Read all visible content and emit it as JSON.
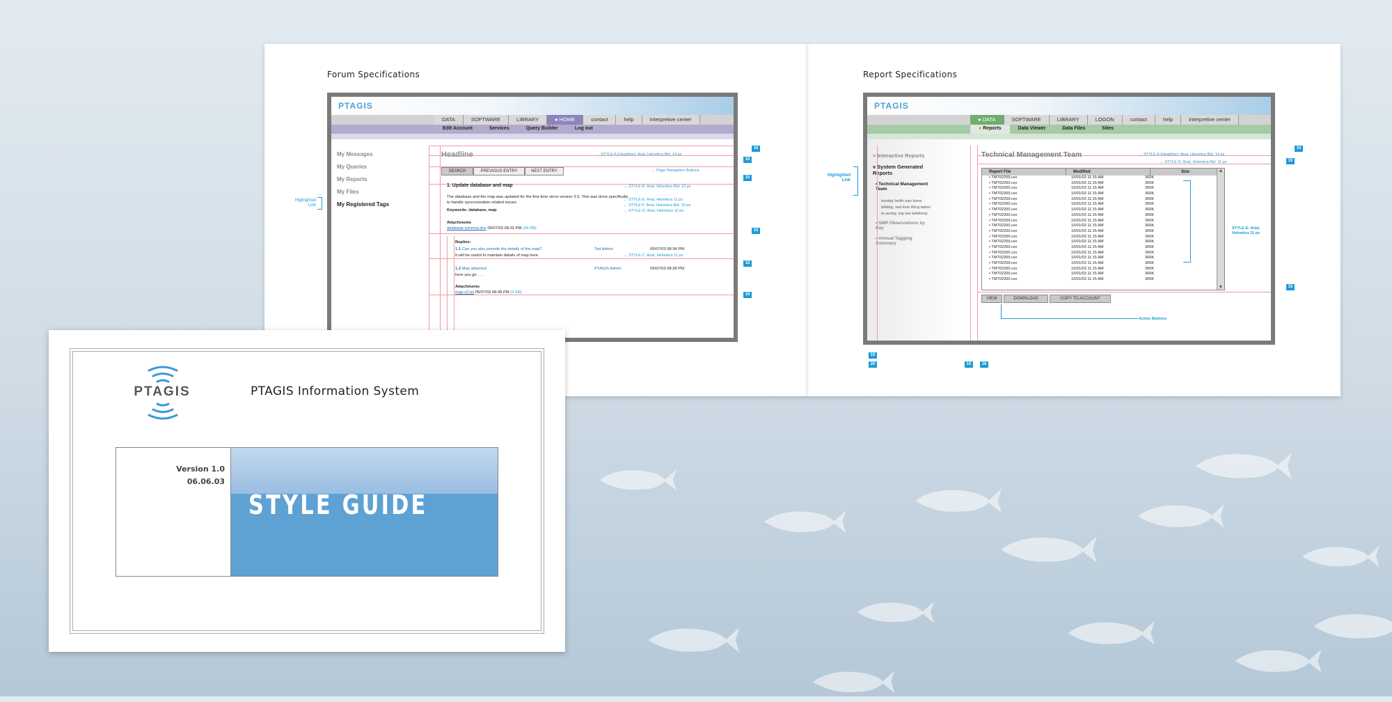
{
  "forum": {
    "title": "Forum Specifications",
    "logo": "PTAGIS",
    "nav": [
      "DATA",
      "SOFTWARE",
      "LIBRARY",
      "HOME",
      "contact",
      "help",
      "interpretive center"
    ],
    "subnav": [
      "Edit Account",
      "Services",
      "Query Builder",
      "Log out"
    ],
    "sidebar": [
      "My Messages",
      "My Queries",
      "My Reports",
      "My Files",
      "My Registered Tags"
    ],
    "highlighted_note": "Highlighted Link",
    "headline": "Headline",
    "buttons": {
      "search": "SEARCH",
      "previous": "PREVIOUS ENTRY",
      "next": "NEXT ENTRY"
    },
    "post_title": "1. Update database and map",
    "post_body_1": "The database and the map was updated for the first time since version 3.5. This was done specifically",
    "post_body_2": "to handle syncronization related issues.",
    "keywords": "Keywords: database, map",
    "attachments_label": "Attachments",
    "attachment1_name": "database schema.doc",
    "attachment1_date": "05/07/03  08:32 PM",
    "attachment1_size": "(35 KB)",
    "replies_label": "Replies:",
    "reply1_num": "1.1",
    "reply1_title": "Can you also provide the details of the map?",
    "reply1_author": "Ted Admin",
    "reply1_date": "05/07/03  08:34 PM",
    "reply1_body": "It will be useful to maintain details of map here.",
    "reply2_num": "1.2",
    "reply2_title": "Map attached",
    "reply2_author": "PTAGIS Admin",
    "reply2_date": "05/07/03  08:38 PM",
    "reply2_body": "here you go . . .",
    "attachment2_name": "map-v2.txt",
    "attachment2_date": "05/07/03  08:38 PM",
    "attachment2_size": "(3 KB)",
    "notes": {
      "a": "STYLE A (Headline): Arial, Helvetica Bld.  14 px",
      "page_nav": "Page Navigation Buttons",
      "b": "STYLE B: Arial, Helvetica Bld.  12 px",
      "e": "STYLE E: Arial, Helvetica  11 px",
      "f": "STYLE F: Arial, Helvetica Bld.  10 px",
      "g": "STYLE G: Arial, Helvetica  10 px",
      "c": "STYLE C: Arial, Helvetica  11 px"
    },
    "spacings": [
      "10",
      "10",
      "10",
      "10",
      "10",
      "16"
    ]
  },
  "report": {
    "title": "Report Specifications",
    "logo": "PTAGIS",
    "nav": [
      "DATA",
      "SOFTWARE",
      "LIBRARY",
      "LOGON",
      "contact",
      "help",
      "interpretive center"
    ],
    "subnav": [
      "Reports",
      "Data Viewer",
      "Data Files",
      "Sites"
    ],
    "sidebar": {
      "interactive": "Interactive Reports",
      "system": "System Generated Reports",
      "tmt": "Technical Management Team",
      "lorem": [
        "hundoj heiifs nau bona",
        "bliddoj, sed kvin libroj batos",
        "la auxtoj, kaj ses telefonoj"
      ],
      "smp": "SMP Observations by Day",
      "annual": "Annual Tagging Summary"
    },
    "highlighted_note": "Highlighted Link",
    "headline": "Technical Management Team",
    "columns": [
      "Report File",
      "Modified",
      "Size"
    ],
    "rows": [
      [
        "TMT02259.csv",
        "10/01/03  11:15 AM",
        "300K"
      ],
      [
        "TMT02260.csv",
        "10/01/03  11:15 AM",
        "300K"
      ],
      [
        "TMT02200.csv",
        "10/01/03  11:15 AM",
        "300K"
      ],
      [
        "TMT02300.csv",
        "10/01/03  11:15 AM",
        "300K"
      ],
      [
        "TMT02259.csv",
        "10/01/03  11:15 AM",
        "300K"
      ],
      [
        "TMT02260.csv",
        "10/01/03  11:15 AM",
        "300K"
      ],
      [
        "TMT02200.csv",
        "10/01/03  11:15 AM",
        "300K"
      ],
      [
        "TMT02300.csv",
        "10/01/03  11:15 AM",
        "300K"
      ],
      [
        "TMT02259.csv",
        "10/01/03  11:15 AM",
        "300K"
      ],
      [
        "TMT02260.csv",
        "10/01/03  11:15 AM",
        "300K"
      ],
      [
        "TMT02200.csv",
        "10/01/03  11:15 AM",
        "300K"
      ],
      [
        "TMT02300.csv",
        "10/01/03  11:15 AM",
        "300K"
      ],
      [
        "TMT02259.csv",
        "10/01/03  11:15 AM",
        "300K"
      ],
      [
        "TMT02260.csv",
        "10/01/03  11:15 AM",
        "300K"
      ],
      [
        "TMT02200.csv",
        "10/01/03  11:15 AM",
        "300K"
      ],
      [
        "TMT02300.csv",
        "10/01/03  11:15 AM",
        "300K"
      ],
      [
        "TMT02259.csv",
        "10/01/03  11:15 AM",
        "300K"
      ],
      [
        "TMT02260.csv",
        "10/01/03  11:15 AM",
        "300K"
      ],
      [
        "TMT02200.csv",
        "10/01/03  11:15 AM",
        "300K"
      ],
      [
        "TMT02300.csv",
        "10/01/03  11:15 AM",
        "300K"
      ]
    ],
    "buttons": [
      "VIEW",
      "DOWNLOAD",
      "COPY TO ACCOUNT"
    ],
    "notes": {
      "a": "STYLE A (Headline): Arial, Helvetica Bld.  14 px",
      "d": "STYLE D: Arial, Helvetica Bld.  11 px",
      "e": "STYLE E: Arial, Helvetica 11 px",
      "action": "Action Buttons"
    },
    "spacings": [
      "10",
      "16",
      "16",
      "10",
      "20",
      "10",
      "16"
    ]
  },
  "cover": {
    "logo": "PTAGIS",
    "system_title": "PTAGIS Information System",
    "version": "Version 1.0",
    "date": "06.06.03",
    "style_guide": "STYLE GUIDE"
  },
  "colors": {
    "accent": "#1b9bd7",
    "guide": "#f29aa8",
    "nav_lavender": "#b3aacd",
    "nav_green": "#a6c9a6",
    "cover_blue": "#5ea2d3"
  }
}
